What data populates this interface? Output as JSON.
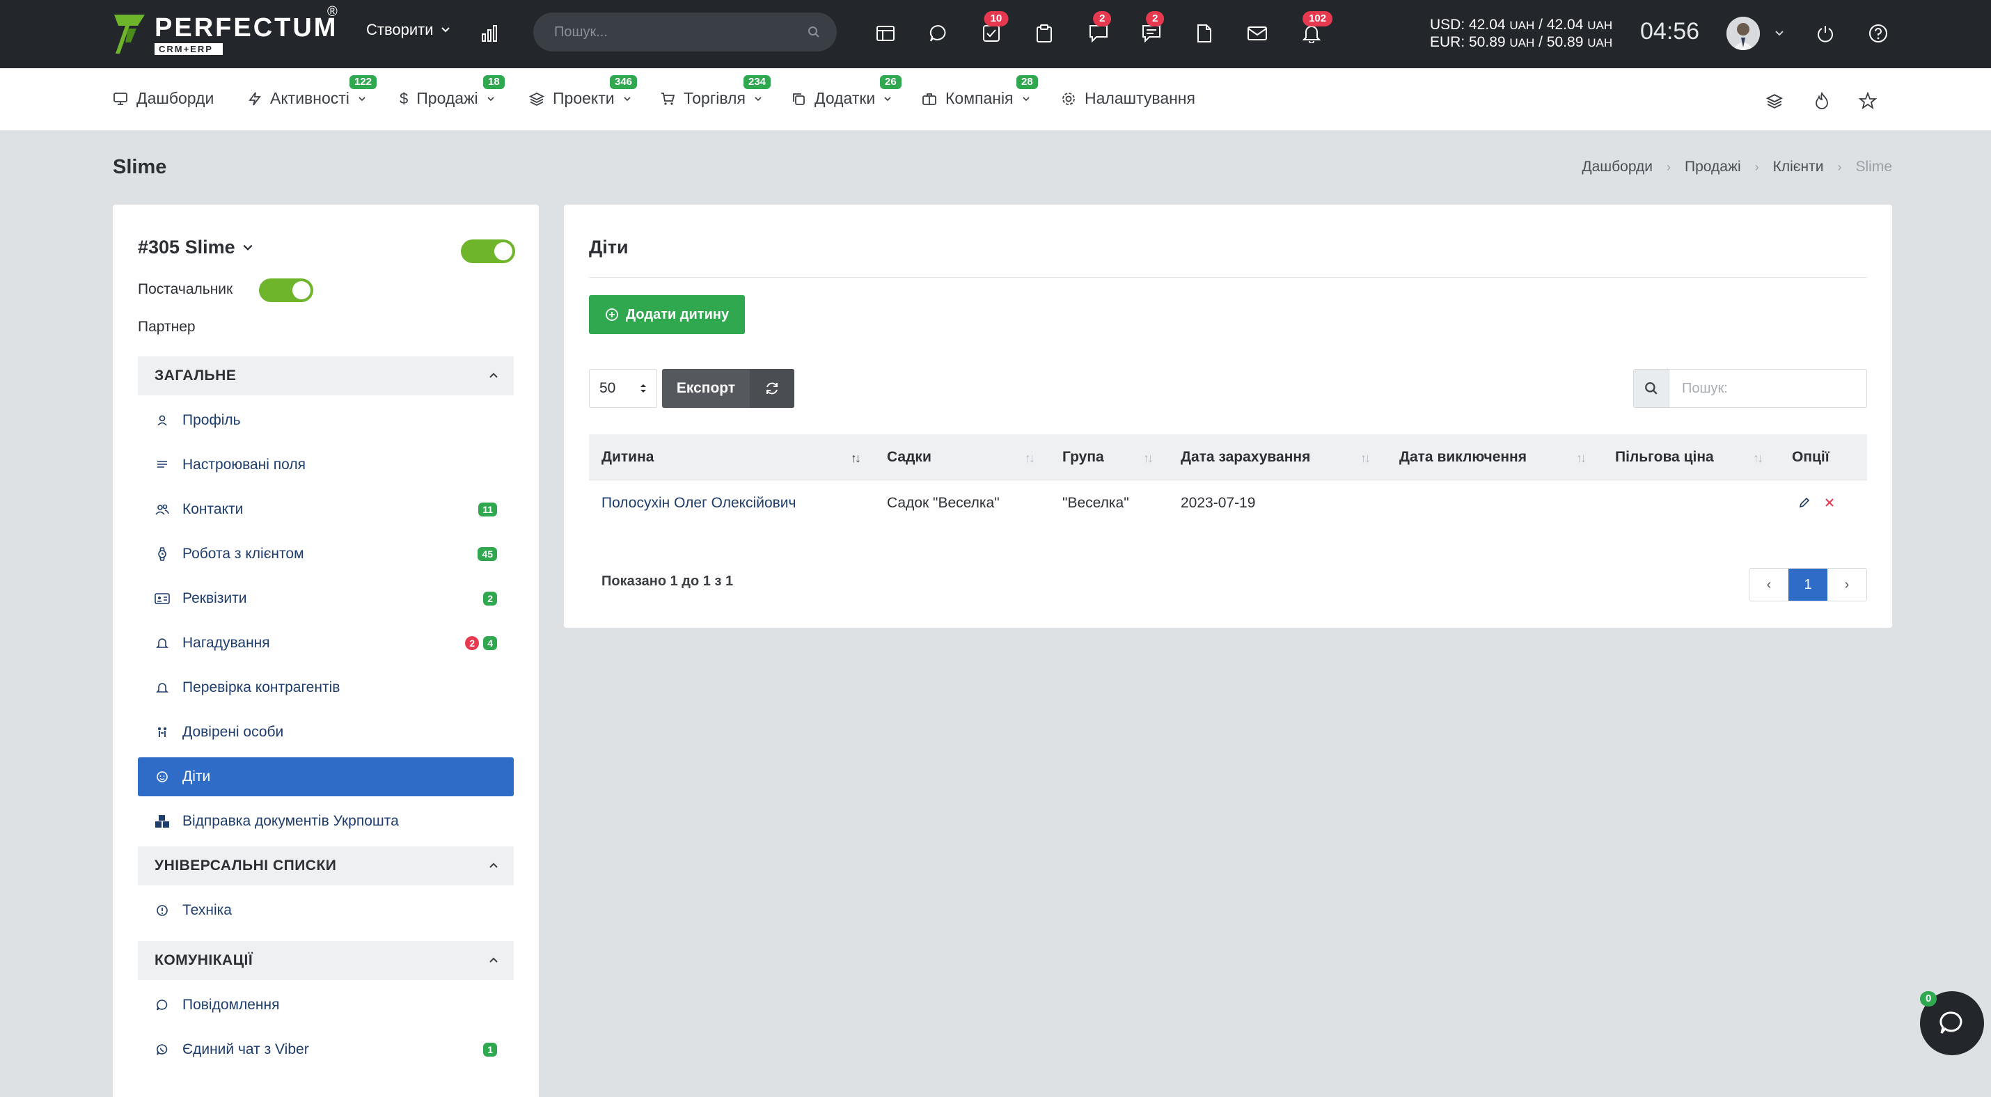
{
  "header": {
    "logo_name": "PERFECTUM",
    "logo_reg": "®",
    "logo_sub": "CRM+ERP",
    "create_label": "Створити",
    "search_placeholder": "Пошук...",
    "badges": {
      "tasks": "10",
      "chat": "2",
      "messages": "2",
      "notifications": "102"
    },
    "rate_usd": "USD: 42.04",
    "rate_usd_u1": "UAH",
    "rate_usd_sep": " / 42.04",
    "rate_usd_u2": "UAH",
    "rate_eur": "EUR: 50.89",
    "rate_eur_u1": "UAH",
    "rate_eur_sep": " / 50.89",
    "rate_eur_u2": "UAH",
    "clock": "04:56",
    "icons": [
      "chart-icon",
      "table-icon",
      "comment-icon",
      "tasks-icon",
      "clipboard-icon",
      "chat-icon",
      "messages-icon",
      "file-icon",
      "mail-icon",
      "bell-icon",
      "power-icon",
      "help-icon"
    ]
  },
  "nav": {
    "items": [
      {
        "label": "Дашборди",
        "badge": ""
      },
      {
        "label": "Активності",
        "badge": "122"
      },
      {
        "label": "Продажі",
        "badge": "18"
      },
      {
        "label": "Проекти",
        "badge": "346"
      },
      {
        "label": "Торгівля",
        "badge": "234"
      },
      {
        "label": "Додатки",
        "badge": "26"
      },
      {
        "label": "Компанія",
        "badge": "28"
      },
      {
        "label": "Налаштування",
        "badge": ""
      }
    ]
  },
  "page": {
    "title": "Slime",
    "breadcrumb": [
      "Дашборди",
      "Продажі",
      "Клієнти",
      "Slime"
    ]
  },
  "client": {
    "title": "#305 Slime",
    "supplier_label": "Постачальник",
    "partner_label": "Партнер",
    "sections": {
      "general": "ЗАГАЛЬНЕ",
      "universal": "УНІВЕРСАЛЬНІ СПИСКИ",
      "comms": "КОМУНІКАЦІЇ"
    },
    "menu": [
      {
        "label": "Профіль"
      },
      {
        "label": "Настроювані поля"
      },
      {
        "label": "Контакти",
        "badge": "11"
      },
      {
        "label": "Робота з клієнтом",
        "badge": "45"
      },
      {
        "label": "Реквізити",
        "badge": "2"
      },
      {
        "label": "Нагадування",
        "badge_red": "2",
        "badge": "4"
      },
      {
        "label": "Перевірка контрагентів"
      },
      {
        "label": "Довірені особи"
      },
      {
        "label": "Діти"
      },
      {
        "label": "Відправка документів Укрпошта"
      }
    ],
    "universal_menu": [
      {
        "label": "Техніка"
      }
    ],
    "comms_menu": [
      {
        "label": "Повідомлення"
      },
      {
        "label": "Єдиний чат з Viber",
        "badge": "1"
      }
    ]
  },
  "children": {
    "title": "Діти",
    "add_button": "Додати дитину",
    "per_page": "50",
    "export_label": "Експорт",
    "search_placeholder": "Пошук:",
    "columns": [
      "Дитина",
      "Садки",
      "Група",
      "Дата зарахування",
      "Дата виключення",
      "Пільгова ціна",
      "Опції"
    ],
    "rows": [
      {
        "child": "Полосухін Олег Олексійович",
        "kindergarten": "Садок \"Веселка\"",
        "group": "\"Веселка\"",
        "enroll_date": "2023-07-19",
        "exclude_date": "",
        "discount_price": ""
      }
    ],
    "shown_text": "Показано 1 до 1 з 1",
    "pager": {
      "prev": "‹",
      "current": "1",
      "next": "›"
    }
  },
  "chat_widget": {
    "badge": "0"
  },
  "colors": {
    "accent_green": "#2fa84f",
    "accent_blue": "#2e6cc8",
    "badge_red": "#e63950",
    "header_bg": "#23272c"
  }
}
